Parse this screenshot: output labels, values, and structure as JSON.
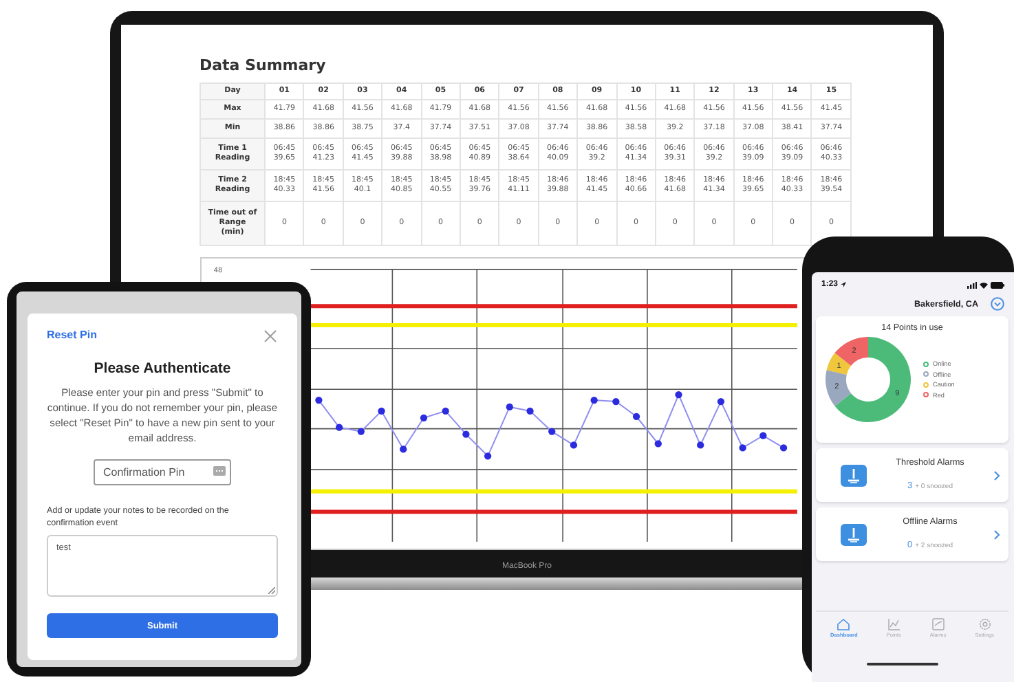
{
  "laptop": {
    "label": "MacBook Pro",
    "data_summary": {
      "title": "Data Summary",
      "rows": [
        {
          "header": "Day",
          "kind": "head",
          "cells": [
            "01",
            "02",
            "03",
            "04",
            "05",
            "06",
            "07",
            "08",
            "09",
            "10",
            "11",
            "12",
            "13",
            "14",
            "15"
          ]
        },
        {
          "header": "Max",
          "kind": "plain",
          "cells": [
            "41.79",
            "41.68",
            "41.56",
            "41.68",
            "41.79",
            "41.68",
            "41.56",
            "41.56",
            "41.68",
            "41.56",
            "41.68",
            "41.56",
            "41.56",
            "41.56",
            "41.45"
          ]
        },
        {
          "header": "Min",
          "kind": "plain",
          "cells": [
            "38.86",
            "38.86",
            "38.75",
            "37.4",
            "37.74",
            "37.51",
            "37.08",
            "37.74",
            "38.86",
            "38.58",
            "39.2",
            "37.18",
            "37.08",
            "38.41",
            "37.74"
          ]
        },
        {
          "header": "Time 1\nReading",
          "kind": "pair",
          "cells": [
            "06:45\n39.65",
            "06:45\n41.23",
            "06:45\n41.45",
            "06:45\n39.88",
            "06:45\n38.98",
            "06:45\n40.89",
            "06:45\n38.64",
            "06:46\n40.09",
            "06:46\n39.2",
            "06:46\n41.34",
            "06:46\n39.31",
            "06:46\n39.2",
            "06:46\n39.09",
            "06:46\n39.09",
            "06:46\n40.33"
          ]
        },
        {
          "header": "Time 2\nReading",
          "kind": "pair",
          "cells": [
            "18:45\n40.33",
            "18:45\n41.56",
            "18:45\n40.1",
            "18:45\n40.85",
            "18:45\n40.55",
            "18:45\n39.76",
            "18:45\n41.11",
            "18:46\n39.88",
            "18:46\n41.45",
            "18:46\n40.66",
            "18:46\n41.68",
            "18:46\n41.34",
            "18:46\n39.65",
            "18:46\n40.33",
            "18:46\n39.54"
          ]
        },
        {
          "header": "Time out of\nRange\n(min)",
          "kind": "tall",
          "cells": [
            "0",
            "0",
            "0",
            "0",
            "0",
            "0",
            "0",
            "0",
            "0",
            "0",
            "0",
            "0",
            "0",
            "0",
            "0"
          ]
        }
      ]
    },
    "chart": {
      "axis_label": "48"
    }
  },
  "tablet": {
    "dialog": {
      "reset_link": "Reset Pin",
      "title": "Please Authenticate",
      "message": "Please enter your pin and press \"Submit\" to continue. If you do not remember your pin, please select \"Reset Pin\" to have a new pin sent to your email address.",
      "pin_field": {
        "placeholder": "Confirmation Pin"
      },
      "notes_label": "Add or update your notes to be recorded on the confirmation event",
      "notes": {
        "value": "test"
      },
      "submit": "Submit"
    }
  },
  "phone": {
    "status_time": "1:23",
    "location": "Bakersfield, CA",
    "points_card": {
      "title": "14 Points in use",
      "chart_data": {
        "type": "donut",
        "categories": [
          "Online",
          "Offline",
          "Caution",
          "Red"
        ],
        "series": [
          {
            "values": [
              9,
              2,
              1,
              2
            ]
          }
        ],
        "data_labels": true
      },
      "legend": [
        {
          "color": "#4cbb7a"
        },
        {
          "color": "#9aa8bf"
        },
        {
          "color": "#f0c63c"
        },
        {
          "color": "#ef6464"
        }
      ]
    },
    "alarm_cards": [
      {
        "title": "Threshold Alarms",
        "count": "3",
        "snoozed": "+ 0 snoozed"
      },
      {
        "title": "Offline Alarms",
        "count": "0",
        "snoozed": "+ 2 snoozed"
      }
    ],
    "tabs": [
      {
        "label": "Dashboard",
        "selected": true
      },
      {
        "label": "Points",
        "selected": false
      },
      {
        "label": "Alarms",
        "selected": false
      },
      {
        "label": "Settings",
        "selected": false
      }
    ]
  }
}
